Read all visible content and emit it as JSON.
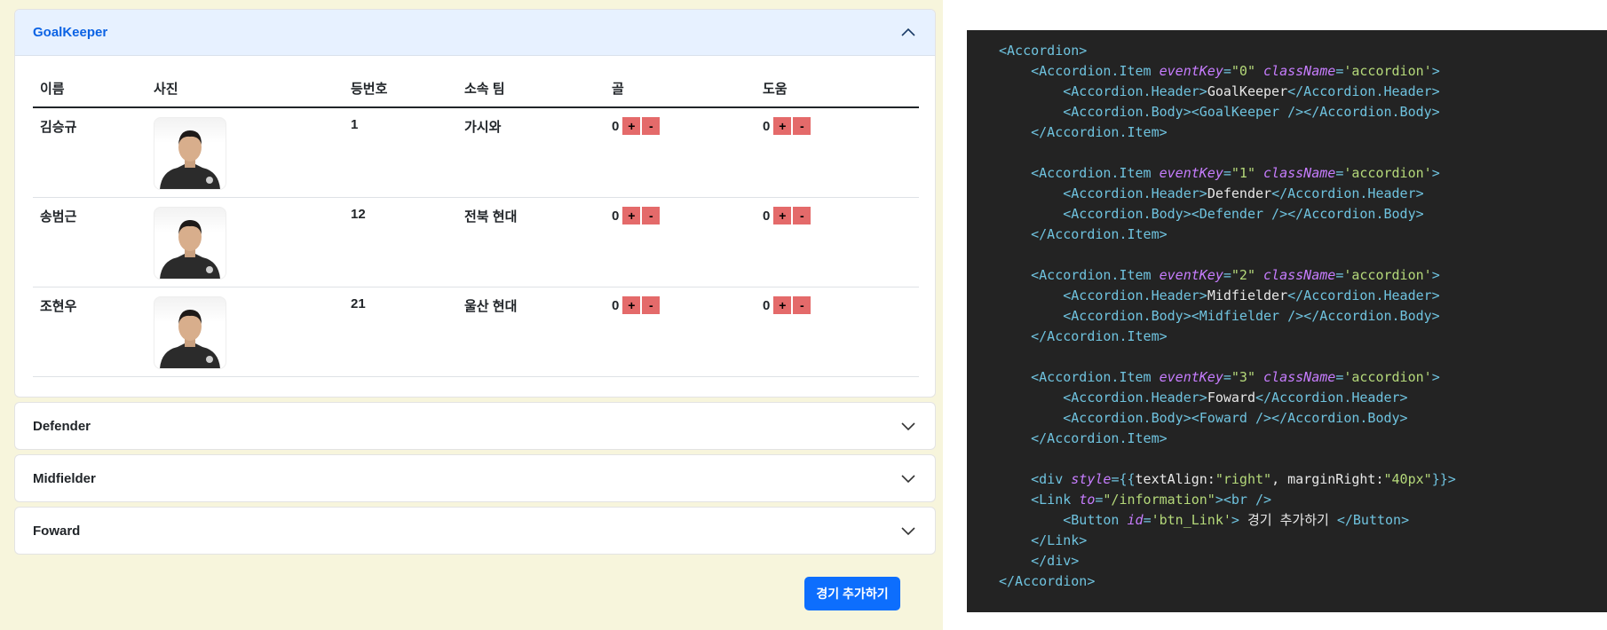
{
  "accordion": {
    "goalkeeper": {
      "title": "GoalKeeper",
      "open": true
    },
    "defender": {
      "title": "Defender"
    },
    "midfielder": {
      "title": "Midfielder"
    },
    "forward": {
      "title": "Foward"
    }
  },
  "table": {
    "headers": [
      "이름",
      "사진",
      "등번호",
      "소속 팀",
      "골",
      "도움"
    ],
    "rows": [
      {
        "name": "김승규",
        "number": "1",
        "team": "가시와",
        "goals": "0",
        "assists": "0"
      },
      {
        "name": "송범근",
        "number": "12",
        "team": "전북 현대",
        "goals": "0",
        "assists": "0"
      },
      {
        "name": "조현우",
        "number": "21",
        "team": "울산 현대",
        "goals": "0",
        "assists": "0"
      }
    ],
    "plus_label": "+",
    "minus_label": "-"
  },
  "submit_button": "경기 추가하기",
  "colors": {
    "accent": "#0d6efd",
    "stat_button": "#e46a6a",
    "open_header_bg": "#e7f1ff"
  },
  "code": [
    [
      [
        "tag",
        "<Accordion>"
      ]
    ],
    [
      [
        "tag",
        "    <Accordion.Item "
      ],
      [
        "attr",
        "eventKey"
      ],
      [
        "tag",
        "="
      ],
      [
        "str",
        "\"0\""
      ],
      [
        "tag",
        " "
      ],
      [
        "attr",
        "className"
      ],
      [
        "tag",
        "="
      ],
      [
        "str",
        "'accordion'"
      ],
      [
        "tag",
        ">"
      ]
    ],
    [
      [
        "tag",
        "        <Accordion.Header>"
      ],
      [
        "txt",
        "GoalKeeper"
      ],
      [
        "tag",
        "</Accordion.Header>"
      ]
    ],
    [
      [
        "tag",
        "        <Accordion.Body><GoalKeeper /></Accordion.Body>"
      ]
    ],
    [
      [
        "tag",
        "    </Accordion.Item>"
      ]
    ],
    [
      [
        "txt",
        ""
      ]
    ],
    [
      [
        "tag",
        "    <Accordion.Item "
      ],
      [
        "attr",
        "eventKey"
      ],
      [
        "tag",
        "="
      ],
      [
        "str",
        "\"1\""
      ],
      [
        "tag",
        " "
      ],
      [
        "attr",
        "className"
      ],
      [
        "tag",
        "="
      ],
      [
        "str",
        "'accordion'"
      ],
      [
        "tag",
        ">"
      ]
    ],
    [
      [
        "tag",
        "        <Accordion.Header>"
      ],
      [
        "txt",
        "Defender"
      ],
      [
        "tag",
        "</Accordion.Header>"
      ]
    ],
    [
      [
        "tag",
        "        <Accordion.Body><Defender /></Accordion.Body>"
      ]
    ],
    [
      [
        "tag",
        "    </Accordion.Item>"
      ]
    ],
    [
      [
        "txt",
        ""
      ]
    ],
    [
      [
        "tag",
        "    <Accordion.Item "
      ],
      [
        "attr",
        "eventKey"
      ],
      [
        "tag",
        "="
      ],
      [
        "str",
        "\"2\""
      ],
      [
        "tag",
        " "
      ],
      [
        "attr",
        "className"
      ],
      [
        "tag",
        "="
      ],
      [
        "str",
        "'accordion'"
      ],
      [
        "tag",
        ">"
      ]
    ],
    [
      [
        "tag",
        "        <Accordion.Header>"
      ],
      [
        "txt",
        "Midfielder"
      ],
      [
        "tag",
        "</Accordion.Header>"
      ]
    ],
    [
      [
        "tag",
        "        <Accordion.Body><Midfielder /></Accordion.Body>"
      ]
    ],
    [
      [
        "tag",
        "    </Accordion.Item>"
      ]
    ],
    [
      [
        "txt",
        ""
      ]
    ],
    [
      [
        "tag",
        "    <Accordion.Item "
      ],
      [
        "attr",
        "eventKey"
      ],
      [
        "tag",
        "="
      ],
      [
        "str",
        "\"3\""
      ],
      [
        "tag",
        " "
      ],
      [
        "attr",
        "className"
      ],
      [
        "tag",
        "="
      ],
      [
        "str",
        "'accordion'"
      ],
      [
        "tag",
        ">"
      ]
    ],
    [
      [
        "tag",
        "        <Accordion.Header>"
      ],
      [
        "txt",
        "Foward"
      ],
      [
        "tag",
        "</Accordion.Header>"
      ]
    ],
    [
      [
        "tag",
        "        <Accordion.Body><Foward /></Accordion.Body>"
      ]
    ],
    [
      [
        "tag",
        "    </Accordion.Item>"
      ]
    ],
    [
      [
        "txt",
        ""
      ]
    ],
    [
      [
        "tag",
        "    <div "
      ],
      [
        "attr",
        "style"
      ],
      [
        "tag",
        "={{"
      ],
      [
        "txt",
        "textAlign:"
      ],
      [
        "str",
        "\"right\""
      ],
      [
        "txt",
        ", marginRight:"
      ],
      [
        "str",
        "\"40px\""
      ],
      [
        "tag",
        "}}>"
      ]
    ],
    [
      [
        "tag",
        "    <Link "
      ],
      [
        "attr",
        "to"
      ],
      [
        "tag",
        "="
      ],
      [
        "str",
        "\"/information\""
      ],
      [
        "tag",
        "><br />"
      ]
    ],
    [
      [
        "tag",
        "        <Button "
      ],
      [
        "attr",
        "id"
      ],
      [
        "tag",
        "="
      ],
      [
        "str",
        "'btn_Link'"
      ],
      [
        "tag",
        ">"
      ],
      [
        "txt",
        " 경기 추가하기 "
      ],
      [
        "tag",
        "</Button>"
      ]
    ],
    [
      [
        "tag",
        "    </Link>"
      ]
    ],
    [
      [
        "tag",
        "    </div>"
      ]
    ],
    [
      [
        "tag",
        "</Accordion>"
      ]
    ]
  ]
}
